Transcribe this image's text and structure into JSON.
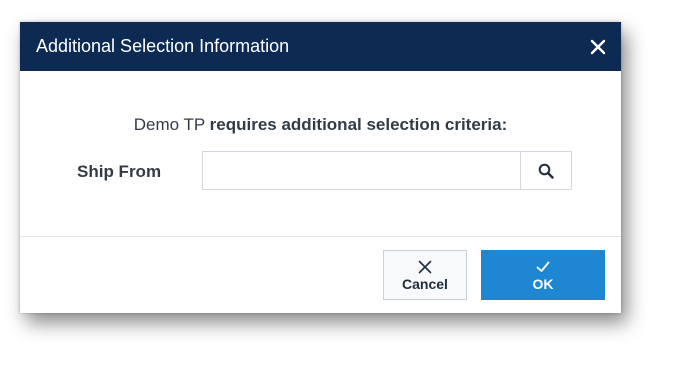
{
  "dialog": {
    "title": "Additional Selection Information",
    "close_icon": "close-icon"
  },
  "message": {
    "prefix": "Demo TP ",
    "text": "requires additional selection criteria:"
  },
  "field": {
    "label": "Ship From",
    "value": "",
    "placeholder": "",
    "search_icon": "search-icon"
  },
  "buttons": {
    "cancel_label": "Cancel",
    "cancel_icon": "close-icon",
    "ok_label": "OK",
    "ok_icon": "checkmark-icon"
  },
  "colors": {
    "titlebar": "#0c2a52",
    "primary": "#1f86d4",
    "text": "#333c46"
  }
}
